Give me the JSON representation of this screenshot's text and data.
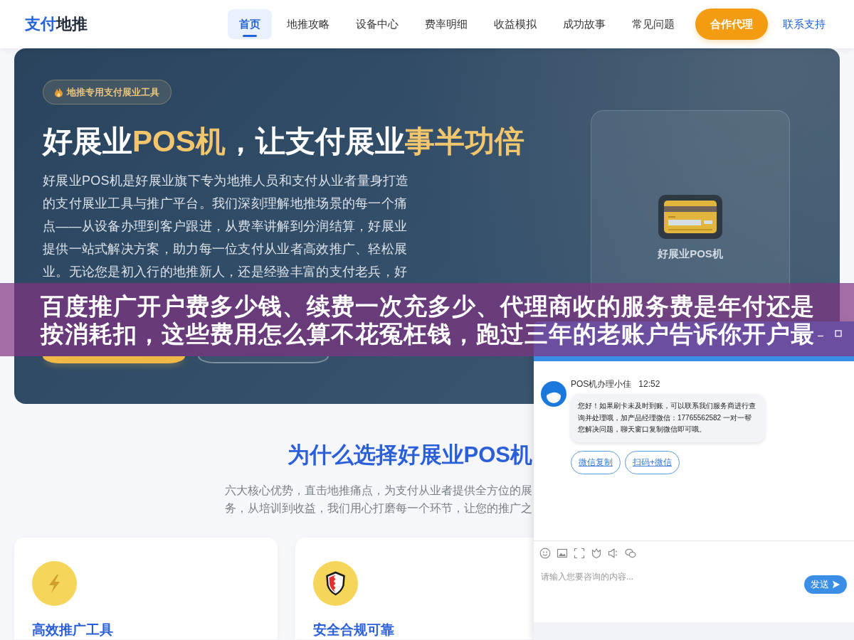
{
  "header": {
    "logo": [
      {
        "text": "支付",
        "accent": true
      },
      {
        "text": "地推",
        "accent": false
      }
    ],
    "nav": [
      {
        "label": "首页",
        "selected": true
      },
      {
        "label": "地推攻略",
        "selected": false
      },
      {
        "label": "设备中心",
        "selected": false
      },
      {
        "label": "费率明细",
        "selected": false
      },
      {
        "label": "收益模拟",
        "selected": false
      },
      {
        "label": "成功故事",
        "selected": false
      },
      {
        "label": "常见问题",
        "selected": false
      }
    ],
    "cta_button": "合作代理",
    "support_link": "联系支持"
  },
  "hero": {
    "badge": "地推专用支付展业工具",
    "headline": [
      {
        "text": "好展业",
        "highlight": false
      },
      {
        "text": "POS机",
        "highlight": true
      },
      {
        "text": "，让支付展业",
        "highlight": false
      },
      {
        "text": "事半功倍",
        "highlight": true
      }
    ],
    "description": "好展业POS机是好展业旗下专为地推人员和支付从业者量身打造的支付展业工具与推广平台。我们深刻理解地推场景的每一个痛点——从设备办理到客户跟进，从费率讲解到分润结算，好展业提供一站式解决方案，助力每一位支付从业者高效推广、轻松展业。无论您是初入行的地推新人，还是经验丰富的支付老兵，好",
    "buttons": [
      {
        "kind": "primary"
      },
      {
        "kind": "outline"
      }
    ],
    "product_card": {
      "label": "好展业POS机"
    }
  },
  "banner": {
    "title": "百度推广开户费多少钱、续费一次充多少、代理商收的服务费是年付还是按消耗扣，这些费用怎么算不花冤枉钱，跑过三年的老账户告诉你开户最"
  },
  "features": {
    "title": "为什么选择好展业POS机",
    "subtitle_lines": [
      "六大核心优势，直击地推痛点，为支付从业者提供全方位的展",
      "务，从培训到收益，我们用心打磨每一个环节，让您的推广之"
    ],
    "cards": [
      {
        "kind": "speed",
        "title": "高效推广工具"
      },
      {
        "kind": "security",
        "title": "安全合规可靠"
      }
    ]
  },
  "chat": {
    "messages": [
      {
        "sender": "POS机办理小佳",
        "time": "12:52",
        "text": "您好！如果刷卡未及时到账，可以联系我们服务商进行查询并处理哦，加产品经理微信：17765562582 一对一帮您解决问题，聊天窗口复制微信即可哦。"
      }
    ],
    "quick_replies": [
      "微信复制",
      "扫码+微信"
    ],
    "input": {
      "placeholder": "请输入您要咨询的内容..."
    },
    "send_button": "发送"
  }
}
